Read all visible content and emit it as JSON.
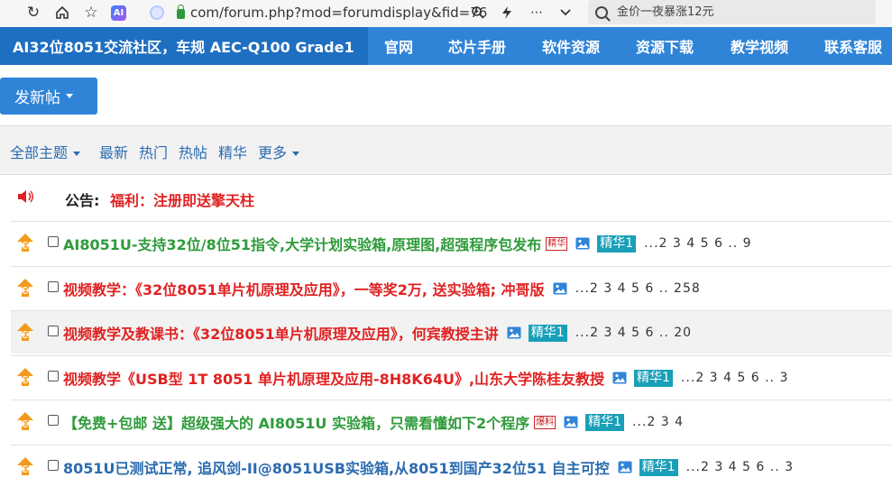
{
  "browser": {
    "url": "com/forum.php?mod=forumdisplay&fid=76",
    "search_placeholder": "金价一夜暴涨12元",
    "ai_badge": "AI"
  },
  "site_nav": {
    "brand": "AI32位8051交流社区，车规 AEC-Q100 Grade1",
    "items": [
      "官网",
      "芯片手册",
      "软件资源",
      "资源下载",
      "教学视频",
      "联系客服"
    ]
  },
  "post_button": "发新帖",
  "filters": {
    "all": "全部主题",
    "latest": "最新",
    "hot": "热门",
    "hot_posts": "热帖",
    "digest": "精华",
    "more": "更多"
  },
  "announcement": {
    "label": "公告:",
    "link": "福利：注册即送擎天柱"
  },
  "colors": {
    "green": "#2e9b3a",
    "red": "#e02222",
    "blue": "#2b6cb0",
    "nav": "#2f84d8",
    "badge": "#1a9fb9"
  },
  "threads": [
    {
      "title": "AI8051U-支持32位/8位51指令,大学计划实验箱,原理图,超强程序包发布",
      "color": "green",
      "tag": "精华",
      "image_icon": true,
      "badge": "精华1",
      "pages": "...2 3 4 5 6 .. 9"
    },
    {
      "title": "视频教学：《32位8051单片机原理及应用》，一等奖2万, 送实验箱; 冲哥版",
      "color": "red",
      "tag": "",
      "image_icon": true,
      "badge": "",
      "pages": "...2 3 4 5 6 .. 258"
    },
    {
      "title": "视频教学及教课书：《32位8051单片机原理及应用》，何宾教授主讲",
      "color": "red",
      "tag": "",
      "image_icon": true,
      "badge": "精华1",
      "pages": "...2 3 4 5 6 .. 20"
    },
    {
      "title": "视频教学《USB型 1T 8051 单片机原理及应用-8H8K64U》,山东大学陈桂友教授",
      "color": "red",
      "tag": "",
      "image_icon": true,
      "badge": "精华1",
      "pages": "...2 3 4 5 6 .. 3"
    },
    {
      "title": "【免费+包邮 送】超级强大的 AI8051U 实验箱，只需看懂如下2个程序",
      "color": "green",
      "tag": "爆料",
      "image_icon": true,
      "badge": "精华1",
      "pages": "...2 3 4"
    },
    {
      "title": "8051U已测试正常, 追风剑-II@8051USB实验箱,从8051到国产32位51 自主可控",
      "color": "blue",
      "tag": "",
      "image_icon": true,
      "badge": "精华1",
      "pages": "...2 3 4 5 6 .. 3"
    }
  ]
}
